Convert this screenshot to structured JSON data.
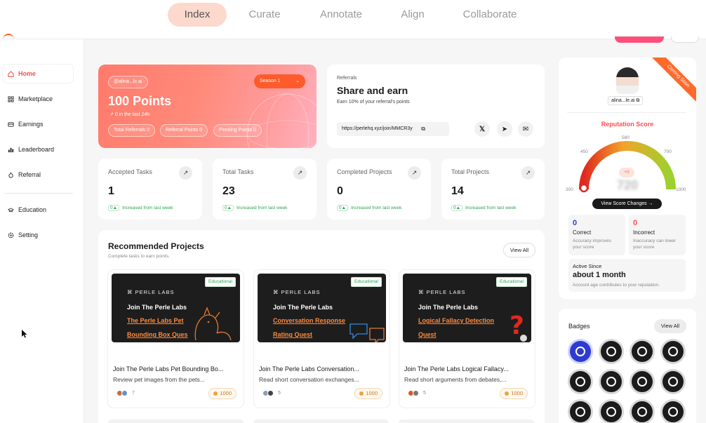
{
  "nav": {
    "tabs": [
      {
        "label": "Index",
        "active": true
      },
      {
        "label": "Curate",
        "active": false
      },
      {
        "label": "Annotate",
        "active": false
      },
      {
        "label": "Align",
        "active": false
      },
      {
        "label": "Collaborate",
        "active": false
      }
    ],
    "accent_color": "#ff4d4f"
  },
  "sidebar": {
    "items": [
      {
        "label": "Home",
        "icon": "home-icon",
        "active": true
      },
      {
        "label": "Marketplace",
        "icon": "marketplace-icon"
      },
      {
        "label": "Earnings",
        "icon": "earnings-icon"
      },
      {
        "label": "Leaderboard",
        "icon": "leaderboard-icon"
      },
      {
        "label": "Referral",
        "icon": "referral-icon"
      },
      {
        "label": "Education",
        "icon": "education-icon"
      },
      {
        "label": "Setting",
        "icon": "setting-icon"
      }
    ]
  },
  "points": {
    "user": "@alina...le.ai",
    "season": "Season 1",
    "value": "100 Points",
    "last24": "0 in the last 24h",
    "chips": [
      "Total Referrals 0",
      "Referral Points 0",
      "Pending Points 0"
    ]
  },
  "referral": {
    "kicker": "Referrals",
    "title": "Share and earn",
    "desc": "Earn 10% of your referral's points",
    "link": "https://perlehq.xyz/join/MMCR3y"
  },
  "stats": [
    {
      "title": "Accepted Tasks",
      "value": "1",
      "delta": "0",
      "sub": "Increased from last week"
    },
    {
      "title": "Total Tasks",
      "value": "23",
      "delta": "0",
      "sub": "Increased from last week"
    },
    {
      "title": "Completed Projects",
      "value": "0",
      "delta": "0",
      "sub": "Increased from last week"
    },
    {
      "title": "Total Projects",
      "value": "14",
      "delta": "0",
      "sub": "Increased from last week"
    }
  ],
  "recommended": {
    "title": "Recommended Projects",
    "subtitle": "Complete tasks to earn points.",
    "view_all": "View All",
    "projects": [
      {
        "tag": "Educational",
        "logo": "PERLE LABS",
        "heading": "Join The Perle Labs",
        "quest_line1": "The Perle Labs Pet",
        "quest_line2": "Bounding Box Ques",
        "name": "Join The Perle Labs Pet Bounding Bo...",
        "desc": "Review pet images from the pets...",
        "participants": "7",
        "reward": "1000"
      },
      {
        "tag": "Educational",
        "logo": "PERLE LABS",
        "heading": "Join The Perle Labs",
        "quest_line1": "Conversation Response",
        "quest_line2": "Rating Quest",
        "name": "Join The Perle Labs Conversation...",
        "desc": "Read short conversation exchanges...",
        "participants": "5",
        "reward": "1000"
      },
      {
        "tag": "Educational",
        "logo": "PERLE LABS",
        "heading": "Join The Perle Labs",
        "quest_line1": "Logical Fallacy Detection",
        "quest_line2": "Quest",
        "name": "Join The Perle Labs Logical Fallacy...",
        "desc": "Read short arguments from debates,...",
        "participants": "5",
        "reward": "1000"
      }
    ]
  },
  "profile": {
    "ribbon": "Coming Soon",
    "user": "alina...le.ai",
    "rep_title": "Reputation Score",
    "gauge_ticks": [
      "300",
      "450",
      "580",
      "700",
      "1000"
    ],
    "score": "720",
    "score_delta": "+0",
    "view_changes": "View Score Changes",
    "correct": {
      "value": "0",
      "label": "Correct",
      "desc1": "Accuracy improves",
      "desc2": "your score"
    },
    "incorrect": {
      "value": "0",
      "label": "Incorrect",
      "desc1": "Inaccuracy can lower",
      "desc2": "your score"
    },
    "active": {
      "label": "Active Since",
      "value": "about 1 month",
      "desc": "Account age contributes to your reputation."
    }
  },
  "badges": {
    "title": "Badges",
    "view_all": "View All",
    "icons": [
      "verified-badge-icon",
      "team-badge-icon",
      "books-badge-icon",
      "medic-badge-icon",
      "brain-badge-icon",
      "runner-badge-icon",
      "diver-badge-icon",
      "hiker-badge-icon",
      "planet-badge-icon",
      "scholar-badge-icon",
      "shield-badge-icon",
      "trophy-badge-icon"
    ]
  }
}
